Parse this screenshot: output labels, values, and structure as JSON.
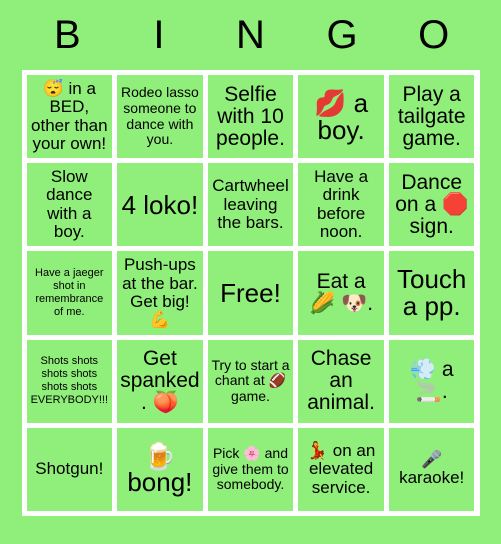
{
  "header": {
    "letters": [
      "B",
      "I",
      "N",
      "G",
      "O"
    ]
  },
  "colors": {
    "background": "#90ee7a",
    "gridline": "#ffffff",
    "text": "#000000"
  },
  "grid": {
    "columns": 5,
    "rows": 5,
    "cells": [
      {
        "text": "😴 in a BED, other than your own!",
        "size": "fs-md"
      },
      {
        "text": "Rodeo lasso someone to dance with you.",
        "size": "fs-sm"
      },
      {
        "text": "Selfie with 10 people.",
        "size": "fs-lg"
      },
      {
        "text": "💋 a boy.",
        "size": "fs-xl"
      },
      {
        "text": "Play a tailgate game.",
        "size": "fs-lg"
      },
      {
        "text": "Slow dance with a boy.",
        "size": "fs-md"
      },
      {
        "text": "4 loko!",
        "size": "fs-xl"
      },
      {
        "text": "Cartwheel leaving the bars.",
        "size": "fs-md"
      },
      {
        "text": "Have a drink before noon.",
        "size": "fs-md"
      },
      {
        "text": "Dance on a 🛑 sign.",
        "size": "fs-lg"
      },
      {
        "text": "Have a jaeger shot in remembrance of me.",
        "size": "fs-xs"
      },
      {
        "text": "Push-ups at the bar. Get big! 💪",
        "size": "fs-md"
      },
      {
        "text": "Free!",
        "size": "fs-xl"
      },
      {
        "text": "Eat a 🌽 🐶.",
        "size": "fs-lg"
      },
      {
        "text": "Touch a pp.",
        "size": "fs-xl"
      },
      {
        "text": "Shots shots shots shots shots shots EVERYBODY!!!",
        "size": "fs-xs"
      },
      {
        "text": "Get spanked. 🍑",
        "size": "fs-lg"
      },
      {
        "text": "Try to start a chant at 🏈 game.",
        "size": "fs-sm"
      },
      {
        "text": "Chase an animal.",
        "size": "fs-lg"
      },
      {
        "text": "💨 a 🚬.",
        "size": "fs-lg"
      },
      {
        "text": "Shotgun!",
        "size": "fs-md"
      },
      {
        "text": "🍺 bong!",
        "size": "fs-xl"
      },
      {
        "text": "Pick 🌸 and give them to somebody.",
        "size": "fs-sm"
      },
      {
        "text": "💃 on an elevated service.",
        "size": "fs-md"
      },
      {
        "text": "🎤 karaoke!",
        "size": "fs-md"
      }
    ]
  }
}
